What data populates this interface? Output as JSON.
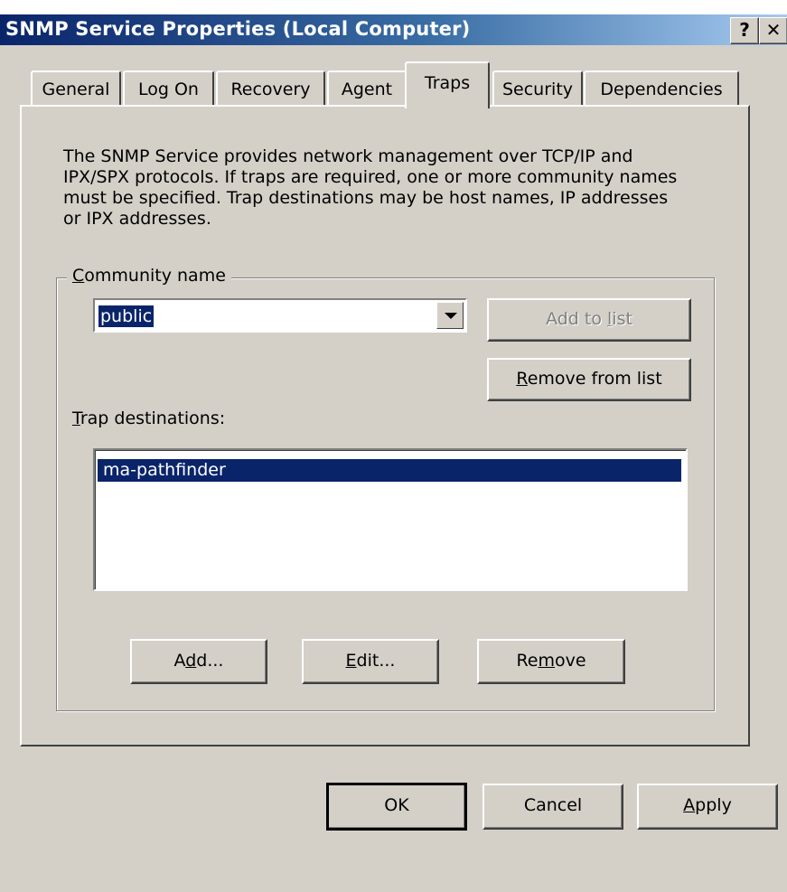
{
  "window": {
    "title": "SNMP Service Properties (Local Computer)",
    "help_glyph": "?",
    "close_glyph": "✕"
  },
  "tabs": [
    {
      "label": "General"
    },
    {
      "label": "Log On"
    },
    {
      "label": "Recovery"
    },
    {
      "label": "Agent"
    },
    {
      "label": "Traps",
      "active": true
    },
    {
      "label": "Security"
    },
    {
      "label": "Dependencies"
    }
  ],
  "traps": {
    "description": "The SNMP Service provides network management over TCP/IP and IPX/SPX protocols. If traps are required, one or more community names must be specified. Trap destinations may be host names, IP addresses or IPX addresses.",
    "community_group_label": "Community name",
    "community_value": "public",
    "add_to_list_label": "Add to list",
    "add_to_list_disabled": true,
    "remove_from_list_label": "Remove from list",
    "trap_destinations_label": "Trap destinations:",
    "destinations": [
      "ma-pathfinder"
    ],
    "add_label": "Add...",
    "edit_label": "Edit...",
    "remove_label": "Remove"
  },
  "footer": {
    "ok_label": "OK",
    "cancel_label": "Cancel",
    "apply_label": "Apply"
  }
}
